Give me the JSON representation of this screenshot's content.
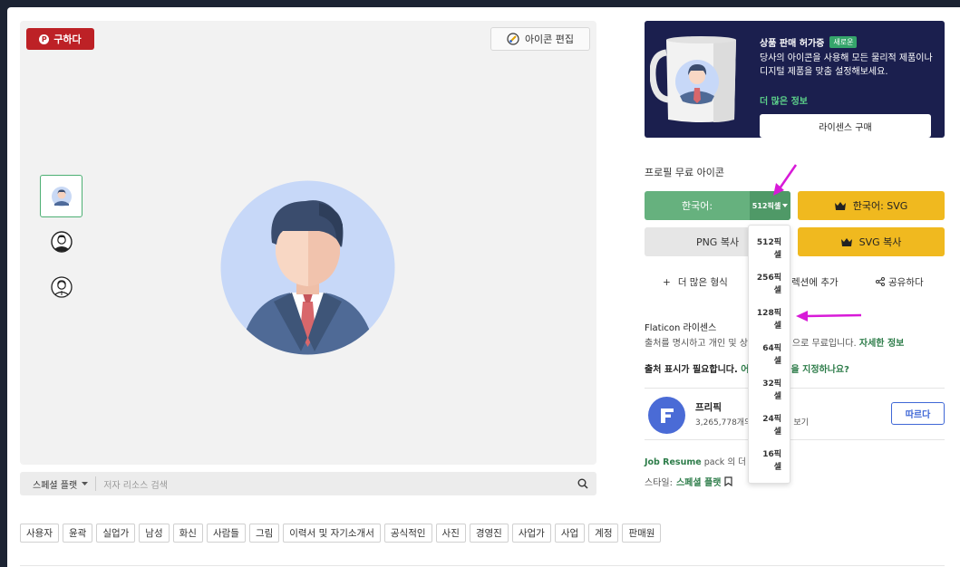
{
  "preview": {
    "pin_label": "구하다",
    "edit_label": "아이콘 편집"
  },
  "searchbar": {
    "style_label": "스페셜 플랫",
    "placeholder": "저자 리소스 검색"
  },
  "tags": [
    "사용자",
    "윤곽",
    "실업가",
    "남성",
    "화신",
    "사람들",
    "그림",
    "이력서 및 자기소개서",
    "공식적인",
    "사진",
    "경영진",
    "사업가",
    "사업",
    "계정",
    "판매원"
  ],
  "promo": {
    "title": "상품 판매 허가증",
    "badge": "새로운",
    "desc": "당사의 아이콘을 사용해 모든 물리적 제품이나 디지털 제품을 맞춤 설정해보세요.",
    "more": "더 많은 정보",
    "button": "라이센스 구매"
  },
  "download": {
    "section_title": "프로필 무료 아이콘",
    "primary_label": "한국어:",
    "size_label": "512픽셀",
    "svg_label": "한국어: SVG",
    "png_copy_label": "PNG 복사",
    "svg_copy_label": "SVG 복사"
  },
  "actions": {
    "more_formats": "더 많은 형식",
    "add_collection": "렉션에 추가",
    "share": "공유하다"
  },
  "license": {
    "title": "Flaticon 라이센스",
    "desc_a": "출처를 명시하고 개인 및 상",
    "desc_b": "으로 무료입니다.",
    "more": "자세한 정보"
  },
  "attribution": {
    "text": "출처 표시가 필요합니다.",
    "link_a": "어",
    "link_b": "을 지정하나요?"
  },
  "author": {
    "name": "프리픽",
    "count": "3,265,778개의",
    "view": "보기",
    "follow": "따르다"
  },
  "pack": {
    "name": "Job Resume",
    "text": "pack 의 더 도"
  },
  "style": {
    "label": "스타일:",
    "value": "스페셜 플랫"
  },
  "size_dropdown": [
    "512픽\n셀",
    "256픽\n셀",
    "128픽\n셀",
    "64픽\n셀",
    "32픽\n셀",
    "24픽\n셀",
    "16픽\n셀"
  ],
  "colors": {
    "green": "#66b17e",
    "yellow": "#f0b91f",
    "navy": "#1b1f4e",
    "pinterest": "#bd2126",
    "annotation": "#d81ad8"
  }
}
